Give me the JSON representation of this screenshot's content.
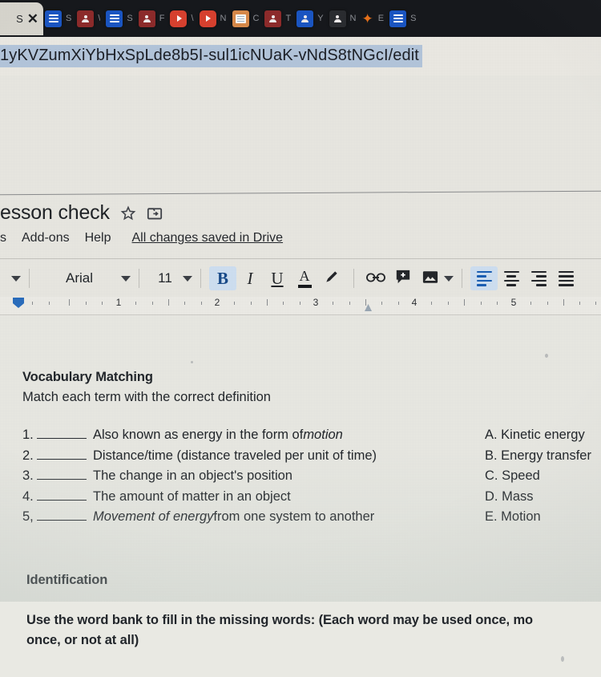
{
  "browser": {
    "active_tab": {
      "label": "S",
      "close_icon": "close-icon"
    },
    "tabs": [
      {
        "favicon": "docs-icon",
        "label": "S"
      },
      {
        "favicon": "account-icon",
        "label": "\\"
      },
      {
        "favicon": "docs-icon",
        "label": "S"
      },
      {
        "favicon": "account-icon",
        "label": "F"
      },
      {
        "favicon": "youtube-icon",
        "label": "\\"
      },
      {
        "favicon": "youtube-icon",
        "label": "N"
      },
      {
        "favicon": "page-icon",
        "label": "C"
      },
      {
        "favicon": "account-icon",
        "label": "T"
      },
      {
        "favicon": "account-icon",
        "label": "Y"
      },
      {
        "favicon": "account-icon",
        "label": "N"
      },
      {
        "favicon": "bolt-icon",
        "label": "E"
      },
      {
        "favicon": "docs-icon",
        "label": "S"
      }
    ],
    "url": "1yKVZumXiYbHxSpLde8b5I-sul1icNUaK-vNdS8tNGcI/edit"
  },
  "docs": {
    "title": "esson check",
    "star_icon": "star-icon",
    "move_icon": "move-to-folder-icon",
    "menu": [
      "s",
      "Add-ons",
      "Help"
    ],
    "save_status": "All changes saved in Drive",
    "toolbar": {
      "style_caret": "chevron-down-icon",
      "font_name": "Arial",
      "font_size": "11",
      "bold": "B",
      "italic": "I",
      "underline": "U",
      "text_color": "A",
      "highlight": "highlighter-icon",
      "link": "link-icon",
      "comment": "add-comment-icon",
      "image": "insert-image-icon",
      "align_left": "align-left-icon",
      "align_center": "align-center-icon",
      "align_right": "align-right-icon",
      "align_justify": "align-justify-icon"
    },
    "ruler": {
      "numbers": [
        "1",
        "2",
        "3",
        "4",
        "5"
      ]
    }
  },
  "document": {
    "section1_heading": "Vocabulary Matching",
    "section1_instruction": "Match each term with the correct definition",
    "match_items": [
      {
        "num": "1.",
        "text_before": "Also known as energy in the form of ",
        "text_italic": "motion",
        "text_after": ""
      },
      {
        "num": "2.",
        "text_before": "Distance/time (distance traveled per unit of time)",
        "text_italic": "",
        "text_after": ""
      },
      {
        "num": "3.",
        "text_before": "The change in an object's position",
        "text_italic": "",
        "text_after": ""
      },
      {
        "num": "4.",
        "text_before": "The amount of matter in an object",
        "text_italic": "",
        "text_after": ""
      },
      {
        "num": "5,",
        "text_before": "",
        "text_italic": "Movement of energy",
        "text_after": " from one system to another"
      }
    ],
    "answer_choices": [
      "A. Kinetic energy",
      "B. Energy transfer",
      "C. Speed",
      "D. Mass",
      "E. Motion"
    ],
    "section2_heading": "Identification",
    "section2_line1": "Use the word bank to fill in the missing words: (Each word may be used once, mo",
    "section2_line2": "once, or not at all)"
  },
  "colors": {
    "tabbar_bg": "#16181c",
    "active_tab_bg": "#d9d7cf",
    "page_bg": "#e9e9e3",
    "url_highlight": "#b4c6dc",
    "accent_blue": "#1a5fb4",
    "docs_blue": "#2a6dbd"
  }
}
